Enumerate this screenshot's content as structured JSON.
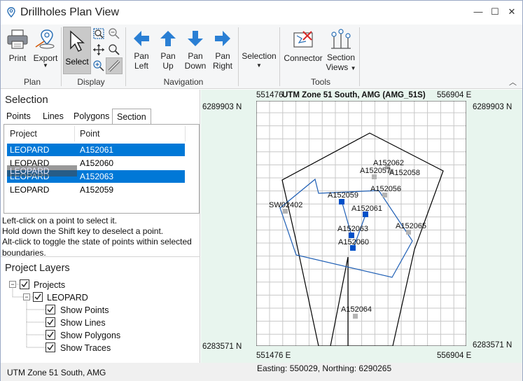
{
  "window": {
    "title": "Drillholes Plan View",
    "minimize": "—",
    "maximize": "☐",
    "close": "✕"
  },
  "ribbon": {
    "plan": {
      "print": "Print",
      "export": "Export",
      "group": "Plan"
    },
    "display": {
      "select": "Select",
      "group": "Display"
    },
    "navigation": {
      "pan_left": [
        "Pan",
        "Left"
      ],
      "pan_up": [
        "Pan",
        "Up"
      ],
      "pan_down": [
        "Pan",
        "Down"
      ],
      "pan_right": [
        "Pan",
        "Right"
      ],
      "group": "Navigation"
    },
    "selection": {
      "label": "Selection"
    },
    "tools": {
      "connector": "Connector",
      "section_views": [
        "Section",
        "Views"
      ],
      "group": "Tools"
    }
  },
  "selection_panel": {
    "heading": "Selection",
    "tabs": [
      "Points",
      "Lines",
      "Polygons",
      "Section"
    ],
    "active_tab": "Section",
    "columns": [
      "Project",
      "Point"
    ],
    "rows": [
      {
        "project": "LEOPARD",
        "point": "A152061",
        "selected": true
      },
      {
        "project": "LEOPARD",
        "point": "A152060",
        "selected": false
      },
      {
        "project": "LEOPARD",
        "point": "A152063",
        "selected": true
      },
      {
        "project": "LEOPARD",
        "point": "A152059",
        "selected": false
      }
    ],
    "drag_ghost": "LEOPARD",
    "help": [
      "Left-click on a point to select it.",
      "Hold down the Shift key to deselect a point.",
      "Alt-click to toggle the state of points within selected boundaries."
    ]
  },
  "layers": {
    "heading": "Project Layers",
    "root": "Projects",
    "project": "LEOPARD",
    "items": [
      "Show Points",
      "Show Lines",
      "Show Polygons",
      "Show Traces"
    ]
  },
  "map": {
    "title": "UTM Zone 51 South, AMG (AMG_51S)",
    "x_min": "551476",
    "x_min_e": "551476 E",
    "x_max": "556904 E",
    "y_max": "6289903 N",
    "y_min": "6283571 N",
    "points_blue": [
      "A152059",
      "A152061",
      "A152063",
      "A152060"
    ],
    "points_grey": [
      "A152062",
      "A152057",
      "A152058",
      "A152056",
      "SW02402",
      "A152065",
      "A152064"
    ],
    "cursor": "Easting: 550029, Northing: 6290265"
  },
  "status": {
    "coord_system": "UTM Zone 51 South, AMG"
  },
  "colors": {
    "accent": "#0078d7",
    "map_bg": "#e8f5ee",
    "blue_point": "#0050c8",
    "grey_point": "#b4b4b4"
  }
}
